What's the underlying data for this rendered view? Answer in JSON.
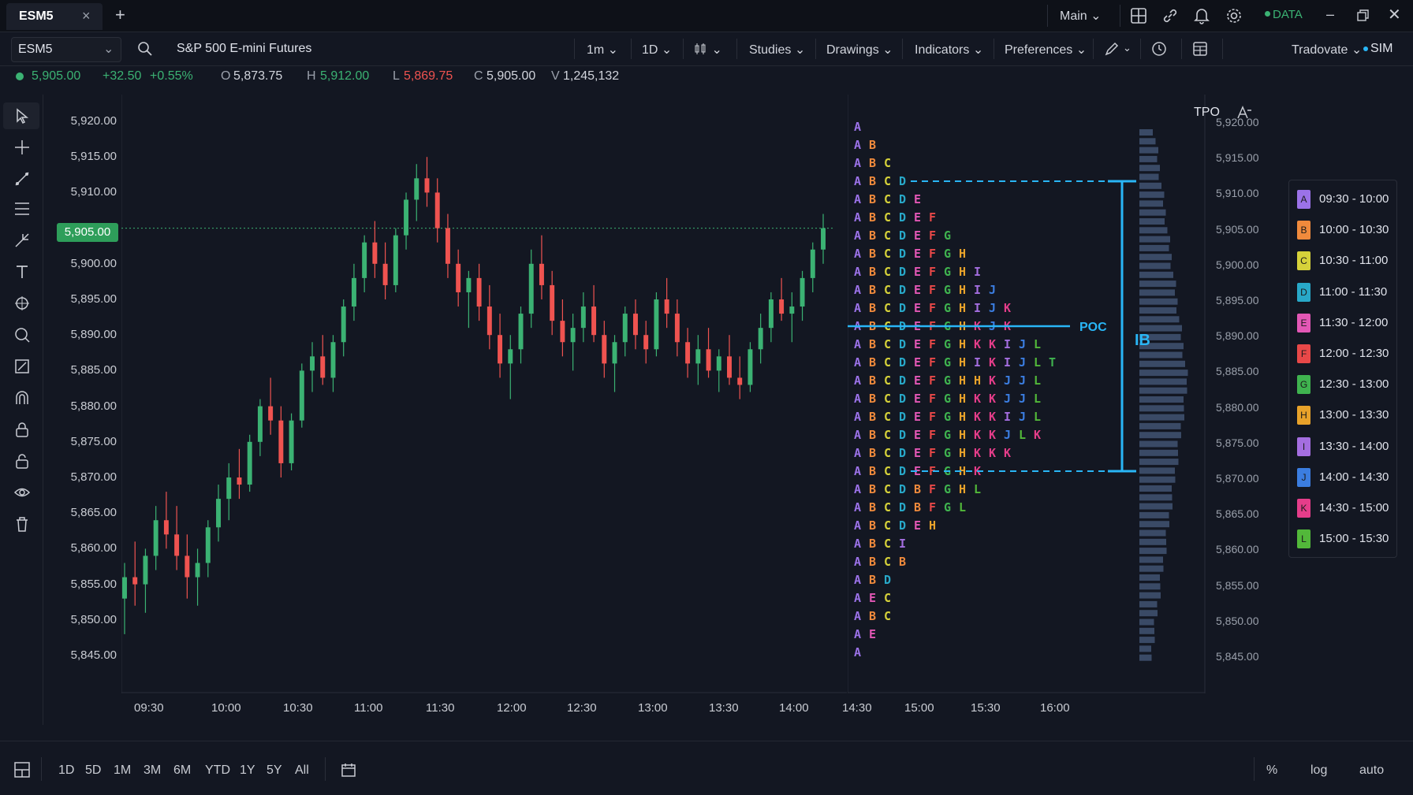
{
  "tab": {
    "title": "ESM5",
    "add": "+"
  },
  "topbar": {
    "workspace": "Main",
    "data_status": "DATA",
    "icons": [
      "layout-icon",
      "link-icon",
      "bell-icon",
      "gear-icon"
    ],
    "window": [
      "minimize-icon",
      "restore-icon",
      "close-icon"
    ]
  },
  "toolbar": {
    "symbol": "ESM5",
    "instrument_name": "S&P 500 E-mini Futures",
    "interval": "1m",
    "range": "1D",
    "studies": "Studies",
    "drawings": "Drawings",
    "indicators": "Indicators",
    "preferences": "Preferences",
    "broker": "Tradovate",
    "account": "SIM"
  },
  "quote": {
    "last": "5,905.00",
    "change": "+32.50",
    "change_pct": "+0.55%",
    "open_label": "O",
    "open": "5,873.75",
    "high_label": "H",
    "high": "5,912.00",
    "low_label": "L",
    "low": "5,869.75",
    "close_label": "C",
    "close": "5,905.00",
    "volume_label": "V",
    "volume": "1,245,132"
  },
  "price_axis_left": [
    "5,920.00",
    "5,915.00",
    "5,910.00",
    "5,905.00",
    "5,900.00",
    "5,895.00",
    "5,890.00",
    "5,885.00",
    "5,880.00",
    "5,875.00",
    "5,870.00",
    "5,865.00",
    "5,860.00",
    "5,855.00",
    "5,850.00",
    "5,845.00"
  ],
  "price_axis_right": [
    "5,920.00",
    "5,915.00",
    "5,910.00",
    "5,905.00",
    "5,900.00",
    "5,895.00",
    "5,890.00",
    "5,885.00",
    "5,880.00",
    "5,875.00",
    "5,870.00",
    "5,865.00",
    "5,860.00",
    "5,855.00",
    "5,850.00",
    "5,845.00"
  ],
  "current_price_badge": "5,905.00",
  "time_axis": [
    "09:30",
    "10:00",
    "10:30",
    "11:00",
    "11:30",
    "12:00",
    "12:30",
    "13:00",
    "13:30",
    "14:00",
    "14:30",
    "15:00",
    "15:30",
    "16:00"
  ],
  "profile": {
    "title": "TPO",
    "poc_label": "POC",
    "ib_label": "IB",
    "rows": [
      "A",
      "AB",
      "ABC",
      "ABCD",
      "ABCDE",
      "ABCDEF",
      "ABCDEFG",
      "ABCDEFGH",
      "ABCDEFGHI",
      "ABCDEFGHIJ",
      "ABCDEFGHIJK",
      "ABCDEFGHKJK",
      "ABCDEFGHKKIJL",
      "ABCDEFGHIKIJLT",
      "ABCDEFGHHKJJL",
      "ABCDEFGHKKJJL",
      "ABCDEFGHKKIJL",
      "ABCDEFGHKKJLK",
      "ABCDEFGHKKK",
      "ABCDEFGHK",
      "ABCDBFGHL",
      "ABCDBFGL",
      "ABCDEH",
      "ABCI",
      "ABCB",
      "ABD",
      "AEC",
      "ABC",
      "AE",
      "A"
    ]
  },
  "legend": [
    {
      "letter": "A",
      "label": "09:30 - 10:00",
      "color": "#9b72e8"
    },
    {
      "letter": "B",
      "label": "10:00 - 10:30",
      "color": "#f08a3c"
    },
    {
      "letter": "C",
      "label": "10:30 - 11:00",
      "color": "#d6d23a"
    },
    {
      "letter": "D",
      "label": "11:00 - 11:30",
      "color": "#28a8c8"
    },
    {
      "letter": "E",
      "label": "11:30 - 12:00",
      "color": "#e257b5"
    },
    {
      "letter": "F",
      "label": "12:00 - 12:30",
      "color": "#e84848"
    },
    {
      "letter": "G",
      "label": "12:30 - 13:00",
      "color": "#3fb34f"
    },
    {
      "letter": "H",
      "label": "13:00 - 13:30",
      "color": "#e8a22a"
    },
    {
      "letter": "I",
      "label": "13:30 - 14:00",
      "color": "#a46ee0"
    },
    {
      "letter": "J",
      "label": "14:00 - 14:30",
      "color": "#3b7de0"
    },
    {
      "letter": "K",
      "label": "14:30 - 15:00",
      "color": "#e53d8a"
    },
    {
      "letter": "L",
      "label": "15:00 - 15:30",
      "color": "#52b83a"
    }
  ],
  "bottom": {
    "ranges": [
      "1D",
      "5D",
      "1M",
      "3M",
      "6M",
      "YTD",
      "1Y",
      "5Y",
      "All"
    ],
    "pct": "%",
    "log": "log",
    "auto": "auto"
  },
  "colors": {
    "up": "#3bb273",
    "down": "#ef5350",
    "poc_line": "#29b6f6",
    "background": "#131722"
  },
  "chart_data": {
    "type": "candlestick",
    "ylim": [
      5843,
      5922
    ],
    "candles": [
      [
        5853,
        5858,
        5848,
        5856
      ],
      [
        5856,
        5861,
        5852,
        5855
      ],
      [
        5855,
        5860,
        5851,
        5859
      ],
      [
        5859,
        5866,
        5857,
        5864
      ],
      [
        5864,
        5868,
        5860,
        5862
      ],
      [
        5862,
        5866,
        5857,
        5859
      ],
      [
        5859,
        5862,
        5853,
        5856
      ],
      [
        5856,
        5860,
        5852,
        5858
      ],
      [
        5858,
        5864,
        5856,
        5863
      ],
      [
        5863,
        5869,
        5861,
        5867
      ],
      [
        5867,
        5872,
        5864,
        5870
      ],
      [
        5870,
        5874,
        5867,
        5869
      ],
      [
        5869,
        5876,
        5868,
        5875
      ],
      [
        5875,
        5881,
        5873,
        5880
      ],
      [
        5880,
        5884,
        5876,
        5878
      ],
      [
        5878,
        5880,
        5870,
        5872
      ],
      [
        5872,
        5879,
        5871,
        5878
      ],
      [
        5878,
        5886,
        5877,
        5885
      ],
      [
        5885,
        5889,
        5882,
        5887
      ],
      [
        5887,
        5890,
        5883,
        5884
      ],
      [
        5884,
        5890,
        5882,
        5889
      ],
      [
        5889,
        5895,
        5887,
        5894
      ],
      [
        5894,
        5900,
        5892,
        5898
      ],
      [
        5898,
        5904,
        5896,
        5903
      ],
      [
        5903,
        5906,
        5898,
        5900
      ],
      [
        5900,
        5903,
        5895,
        5897
      ],
      [
        5897,
        5905,
        5896,
        5904
      ],
      [
        5904,
        5910,
        5902,
        5909
      ],
      [
        5909,
        5914,
        5906,
        5912
      ],
      [
        5912,
        5915,
        5908,
        5910
      ],
      [
        5910,
        5912,
        5903,
        5905
      ],
      [
        5905,
        5907,
        5898,
        5900
      ],
      [
        5900,
        5902,
        5894,
        5896
      ],
      [
        5896,
        5899,
        5891,
        5898
      ],
      [
        5898,
        5900,
        5892,
        5894
      ],
      [
        5894,
        5897,
        5888,
        5890
      ],
      [
        5890,
        5893,
        5884,
        5886
      ],
      [
        5886,
        5890,
        5881,
        5888
      ],
      [
        5888,
        5894,
        5886,
        5893
      ],
      [
        5893,
        5902,
        5891,
        5900
      ],
      [
        5900,
        5904,
        5895,
        5897
      ],
      [
        5897,
        5899,
        5890,
        5892
      ],
      [
        5892,
        5895,
        5887,
        5889
      ],
      [
        5889,
        5893,
        5885,
        5891
      ],
      [
        5891,
        5896,
        5889,
        5894
      ],
      [
        5894,
        5897,
        5889,
        5890
      ],
      [
        5890,
        5892,
        5884,
        5886
      ],
      [
        5886,
        5890,
        5882,
        5889
      ],
      [
        5889,
        5894,
        5887,
        5893
      ],
      [
        5893,
        5895,
        5888,
        5890
      ],
      [
        5890,
        5892,
        5886,
        5888
      ],
      [
        5888,
        5896,
        5887,
        5895
      ],
      [
        5895,
        5898,
        5891,
        5893
      ],
      [
        5893,
        5895,
        5887,
        5889
      ],
      [
        5889,
        5891,
        5884,
        5886
      ],
      [
        5886,
        5890,
        5883,
        5888
      ],
      [
        5888,
        5891,
        5884,
        5885
      ],
      [
        5885,
        5888,
        5882,
        5887
      ],
      [
        5887,
        5890,
        5883,
        5884
      ],
      [
        5884,
        5887,
        5881,
        5883
      ],
      [
        5883,
        5889,
        5882,
        5888
      ],
      [
        5888,
        5893,
        5886,
        5891
      ],
      [
        5891,
        5896,
        5889,
        5895
      ],
      [
        5895,
        5898,
        5892,
        5893
      ],
      [
        5893,
        5896,
        5889,
        5894
      ],
      [
        5894,
        5899,
        5892,
        5898
      ],
      [
        5898,
        5903,
        5896,
        5902
      ],
      [
        5902,
        5907,
        5900,
        5905
      ]
    ]
  }
}
